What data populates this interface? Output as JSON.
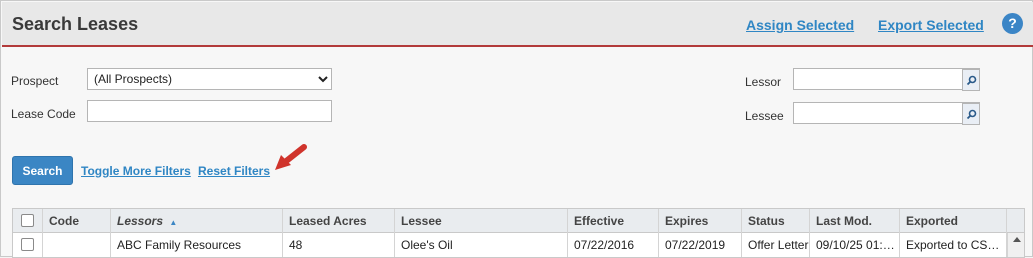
{
  "header": {
    "title": "Search Leases",
    "assign_selected": "Assign Selected",
    "export_selected": "Export Selected",
    "help": "?"
  },
  "filters": {
    "prospect_label": "Prospect",
    "prospect_value": "(All Prospects)",
    "lease_code_label": "Lease Code",
    "lease_code_value": "",
    "lessor_label": "Lessor",
    "lessor_value": "",
    "lessee_label": "Lessee",
    "lessee_value": ""
  },
  "actions": {
    "search": "Search",
    "toggle_more_filters": "Toggle More Filters",
    "reset_filters": "Reset Filters"
  },
  "colors": {
    "accent": "#3b86c4",
    "header_rule": "#b23a3a",
    "annotation_arrow": "#d0342c"
  },
  "grid": {
    "sort_indicator": "▲",
    "columns": [
      "Code",
      "Lessors",
      "Leased Acres",
      "Lessee",
      "Effective",
      "Expires",
      "Status",
      "Last Mod.",
      "Exported"
    ],
    "sorted_column": "Lessors",
    "rows": [
      {
        "code": "",
        "lessors": "ABC Family Resources",
        "leased_acres": "48",
        "lessee": "Olee's Oil",
        "effective": "07/22/2016",
        "expires": "07/22/2019",
        "status": "Offer Letter",
        "last_mod": "09/10/25 01:…",
        "exported": "Exported to CS…"
      }
    ]
  }
}
